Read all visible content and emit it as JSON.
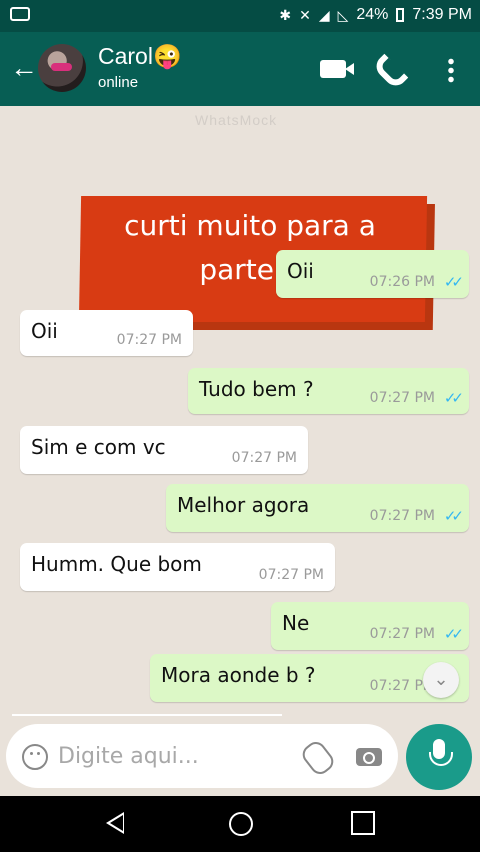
{
  "status_bar": {
    "battery": "24%",
    "time": "7:39 PM"
  },
  "contact": {
    "name": "Carol😜",
    "status": "online"
  },
  "watermark": "WhatsMock",
  "sticker": {
    "line1": "curti muito para a",
    "line2": "parte 2"
  },
  "messages": [
    {
      "dir": "out",
      "text": "Oii",
      "time": "07:26 PM",
      "ticks": "✓✓"
    },
    {
      "dir": "in",
      "text": "Oii",
      "time": "07:27 PM"
    },
    {
      "dir": "out",
      "text": "Tudo bem ?",
      "time": "07:27 PM",
      "ticks": "✓✓"
    },
    {
      "dir": "in",
      "text": "Sim e com vc",
      "time": "07:27 PM"
    },
    {
      "dir": "out",
      "text": "Melhor agora",
      "time": "07:27 PM",
      "ticks": "✓✓"
    },
    {
      "dir": "in",
      "text": "Humm. Que bom",
      "time": "07:27 PM"
    },
    {
      "dir": "out",
      "text": "Ne",
      "time": "07:27 PM",
      "ticks": "✓✓"
    },
    {
      "dir": "out",
      "text": "Mora aonde b ?",
      "time": "07:27 PM"
    }
  ],
  "input": {
    "placeholder": "Digite aqui..."
  }
}
